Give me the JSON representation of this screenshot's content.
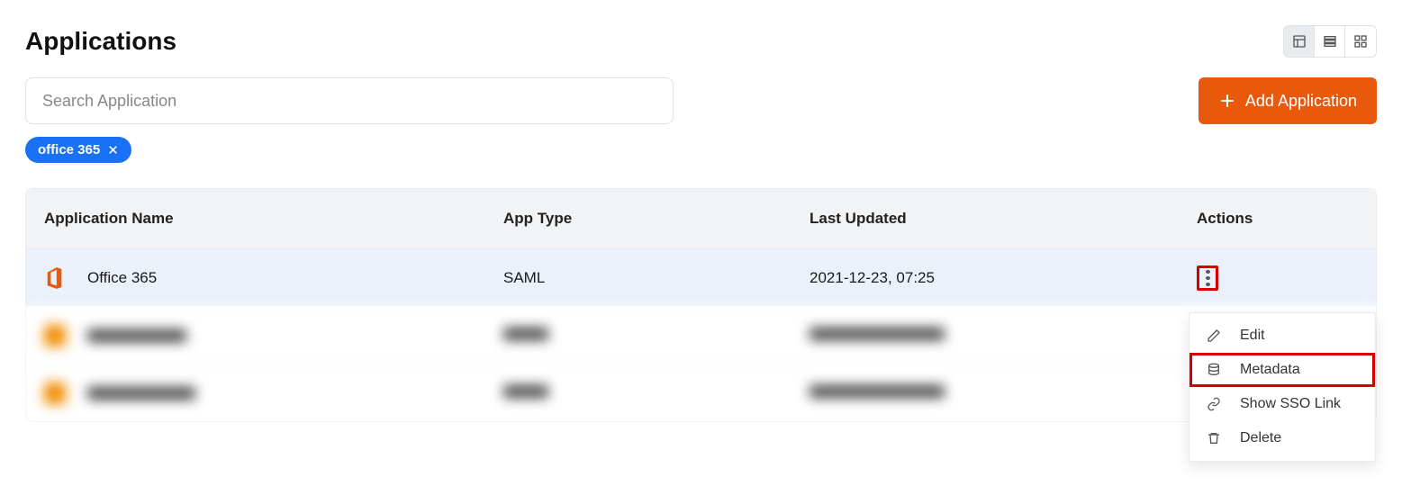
{
  "page": {
    "title": "Applications"
  },
  "search": {
    "placeholder": "Search Application"
  },
  "filter_chip": {
    "label": "office 365"
  },
  "add_button": {
    "label": "Add Application"
  },
  "table": {
    "headers": {
      "name": "Application Name",
      "type": "App Type",
      "updated": "Last Updated",
      "actions": "Actions"
    },
    "rows": [
      {
        "name": "Office 365",
        "type": "SAML",
        "updated": "2021-12-23, 07:25"
      }
    ]
  },
  "dropdown": {
    "edit": "Edit",
    "metadata": "Metadata",
    "show_sso": "Show SSO Link",
    "delete": "Delete"
  }
}
